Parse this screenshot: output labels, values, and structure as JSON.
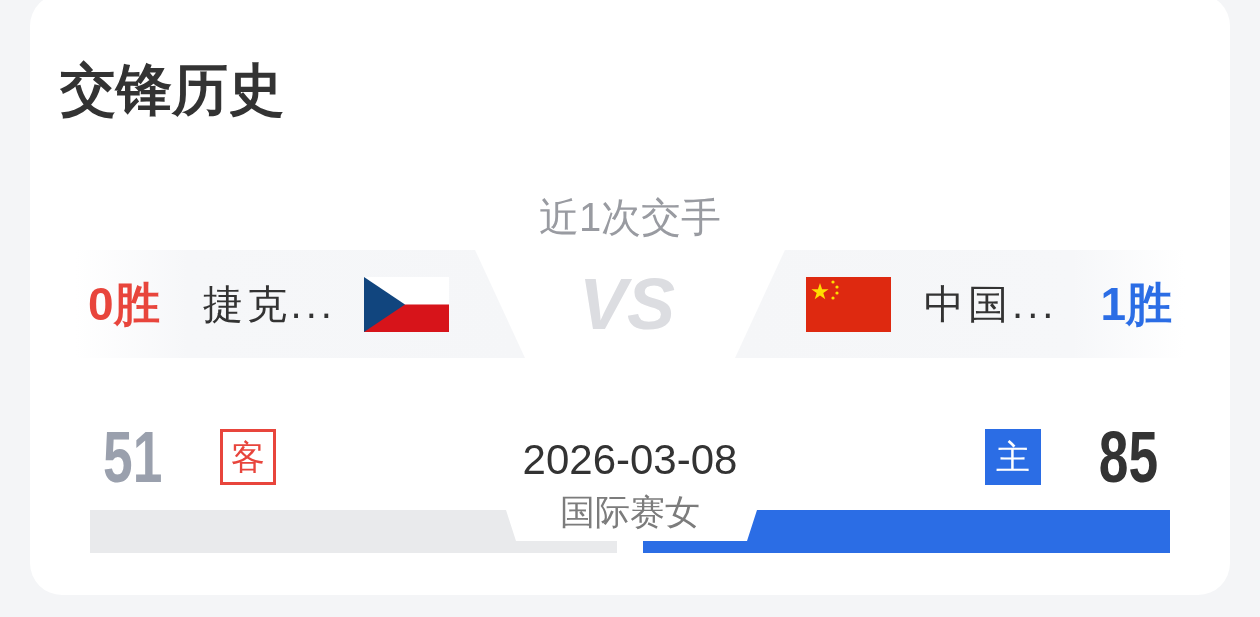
{
  "title": "交锋历史",
  "head_to_head": {
    "subtitle": "近1次交手",
    "vs_label": "VS",
    "teams": [
      {
        "wins": "0胜",
        "color": "#e8453c",
        "name": "捷克..."
      },
      {
        "wins": "1胜",
        "color": "#2b6de5",
        "name": "中国..."
      }
    ]
  },
  "match": {
    "date": "2026-03-08",
    "competition": "国际赛女",
    "results": [
      {
        "kind": "away",
        "score": "51",
        "badge": "客",
        "color": "#e8453c",
        "won": false
      },
      {
        "kind": "home",
        "score": "85",
        "badge": "主",
        "color": "#2b6de5",
        "won": true
      }
    ]
  }
}
